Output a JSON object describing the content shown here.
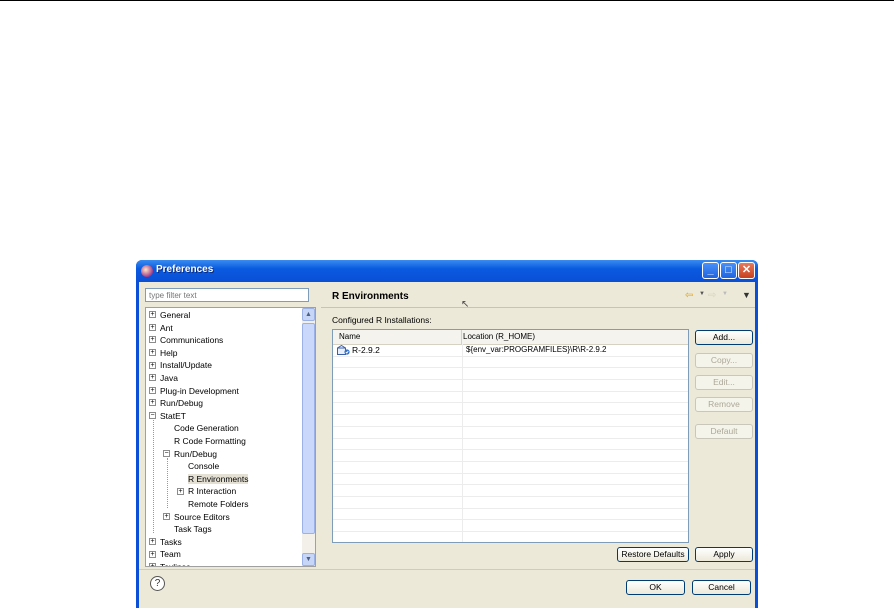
{
  "window": {
    "title": "Preferences"
  },
  "filter": {
    "placeholder": "type filter text"
  },
  "tree": {
    "items": [
      {
        "label": "General",
        "expander": "+"
      },
      {
        "label": "Ant",
        "expander": "+"
      },
      {
        "label": "Communications",
        "expander": "+"
      },
      {
        "label": "Help",
        "expander": "+"
      },
      {
        "label": "Install/Update",
        "expander": "+"
      },
      {
        "label": "Java",
        "expander": "+"
      },
      {
        "label": "Plug-in Development",
        "expander": "+"
      },
      {
        "label": "Run/Debug",
        "expander": "+"
      },
      {
        "label": "StatET",
        "expander": "−"
      },
      {
        "label": "Code Generation",
        "expander": ""
      },
      {
        "label": "R Code Formatting",
        "expander": ""
      },
      {
        "label": "Run/Debug",
        "expander": "−"
      },
      {
        "label": "Console",
        "expander": ""
      },
      {
        "label": "R Environments",
        "expander": "",
        "selected": true
      },
      {
        "label": "R Interaction",
        "expander": "+"
      },
      {
        "label": "Remote Folders",
        "expander": ""
      },
      {
        "label": "Source Editors",
        "expander": "+"
      },
      {
        "label": "Task Tags",
        "expander": ""
      },
      {
        "label": "Tasks",
        "expander": "+"
      },
      {
        "label": "Team",
        "expander": "+"
      },
      {
        "label": "Texlipse",
        "expander": "+"
      }
    ]
  },
  "page": {
    "title": "R Environments",
    "config_label": "Configured R Installations:"
  },
  "table": {
    "columns": [
      "Name",
      "Location (R_HOME)"
    ],
    "rows": [
      {
        "name": "R-2.9.2",
        "location": "${env_var:PROGRAMFILES}\\R\\R-2.9.2"
      }
    ]
  },
  "buttons": {
    "add": "Add...",
    "copy": "Copy...",
    "edit": "Edit...",
    "remove": "Remove",
    "default": "Default",
    "restore_defaults": "Restore Defaults",
    "apply": "Apply",
    "ok": "OK",
    "cancel": "Cancel"
  },
  "icons": {
    "help": "help-icon",
    "back": "back-arrow-icon",
    "forward": "forward-arrow-icon",
    "view_menu": "view-menu-icon"
  },
  "colors": {
    "titlebar": "#0a4fd6",
    "dialog_bg": "#ece9d8",
    "back_arrow": "#e3a21a"
  }
}
